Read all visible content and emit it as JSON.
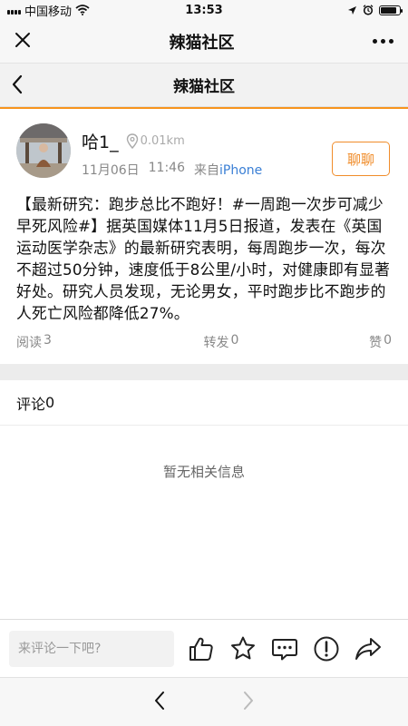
{
  "status_bar": {
    "carrier": "中国移动",
    "time": "13:53",
    "battery_level": 0.85
  },
  "wechat_nav": {
    "title": "辣猫社区"
  },
  "page_nav": {
    "title": "辣猫社区"
  },
  "post": {
    "username": "哈1_",
    "distance": "0.01km",
    "date": "11月06日",
    "time": "11:46",
    "source_prefix": "来自",
    "source_device": "iPhone",
    "chat_button": "聊聊",
    "body": "【最新研究：跑步总比不跑好！#一周跑一次步可减少早死风险#】据英国媒体11月5日报道，发表在《英国运动医学杂志》的最新研究表明，每周跑步一次，每次不超过50分钟，速度低于8公里/小时，对健康即有显著好处。研究人员发现，无论男女，平时跑步比不跑步的人死亡风险都降低27%。",
    "stats": {
      "read_label": "阅读",
      "read_count": "3",
      "repost_label": "转发",
      "repost_count": "0",
      "like_label": "赞",
      "like_count": "0"
    }
  },
  "comments": {
    "label": "评论",
    "count": "0",
    "empty_text": "暂无相关信息"
  },
  "comment_bar": {
    "placeholder": "来评论一下吧?"
  },
  "colors": {
    "accent": "#f08c2a",
    "link": "#3a7fd5"
  },
  "icons": {
    "close": "close-icon",
    "more": "more-icon",
    "back": "back-arrow-icon",
    "location": "location-pin-icon",
    "like": "thumbs-up-icon",
    "favorite": "star-icon",
    "comment": "comment-bubble-icon",
    "report": "alert-icon",
    "share": "share-icon",
    "browser_back": "chevron-left-icon",
    "browser_forward": "chevron-right-icon"
  }
}
